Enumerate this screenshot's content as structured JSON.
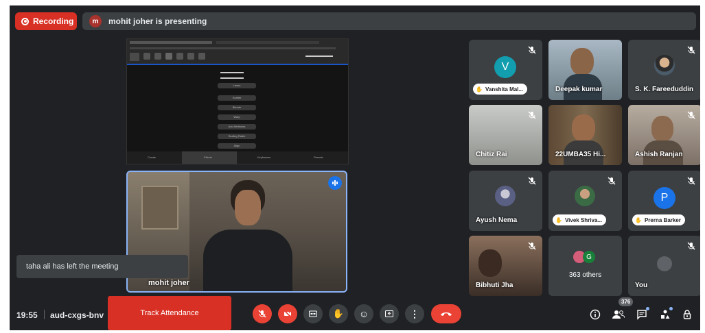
{
  "recording": {
    "label": "Recording"
  },
  "presenter_bar": {
    "avatar_letter": "m",
    "text": "mohit joher is presenting"
  },
  "presenter_tile": {
    "name": "mohit joher"
  },
  "toast": {
    "text": "taha ali has left the meeting"
  },
  "participants": [
    {
      "name": "Vanshita Mal...",
      "avatar": "V",
      "avatar_color": "#129eaf",
      "style": "pill"
    },
    {
      "name": "Deepak kumar",
      "style": "video"
    },
    {
      "name": "S. K. Fareeduddin",
      "style": "photo"
    },
    {
      "name": "Chitiz Rai",
      "style": "video"
    },
    {
      "name": "22UMBA35 Hi...",
      "style": "video"
    },
    {
      "name": "Ashish Ranjan",
      "style": "video"
    },
    {
      "name": "Ayush Nema",
      "style": "photo"
    },
    {
      "name": "Vivek Shriva...",
      "style": "pill-photo"
    },
    {
      "name": "Prerna Barker",
      "avatar": "P",
      "avatar_color": "#1a73e8",
      "style": "pill"
    },
    {
      "name": "Bibhuti Jha",
      "style": "video"
    },
    {
      "name": "363 others",
      "avatar": "G",
      "avatar_color": "#188038",
      "style": "others"
    },
    {
      "name": "You",
      "style": "self"
    }
  ],
  "bottom_bar": {
    "time": "19:55",
    "meeting_code": "aud-cxgs-bnv",
    "track_attendance": "Track Attendance",
    "people_count": "376"
  },
  "shared_screen": {
    "menu_items": [
      "Lasso",
      "Scatter",
      "Blends",
      "Warp",
      "Add Attributes",
      "Scaling Radio",
      "Align"
    ],
    "bottom_tabs": [
      "Create",
      "Effects",
      "Keyframes",
      "Presets"
    ]
  },
  "colors": {
    "accent": "#8ab4f8",
    "danger": "#ea4335",
    "surface": "#3c4043",
    "background": "#202124"
  }
}
